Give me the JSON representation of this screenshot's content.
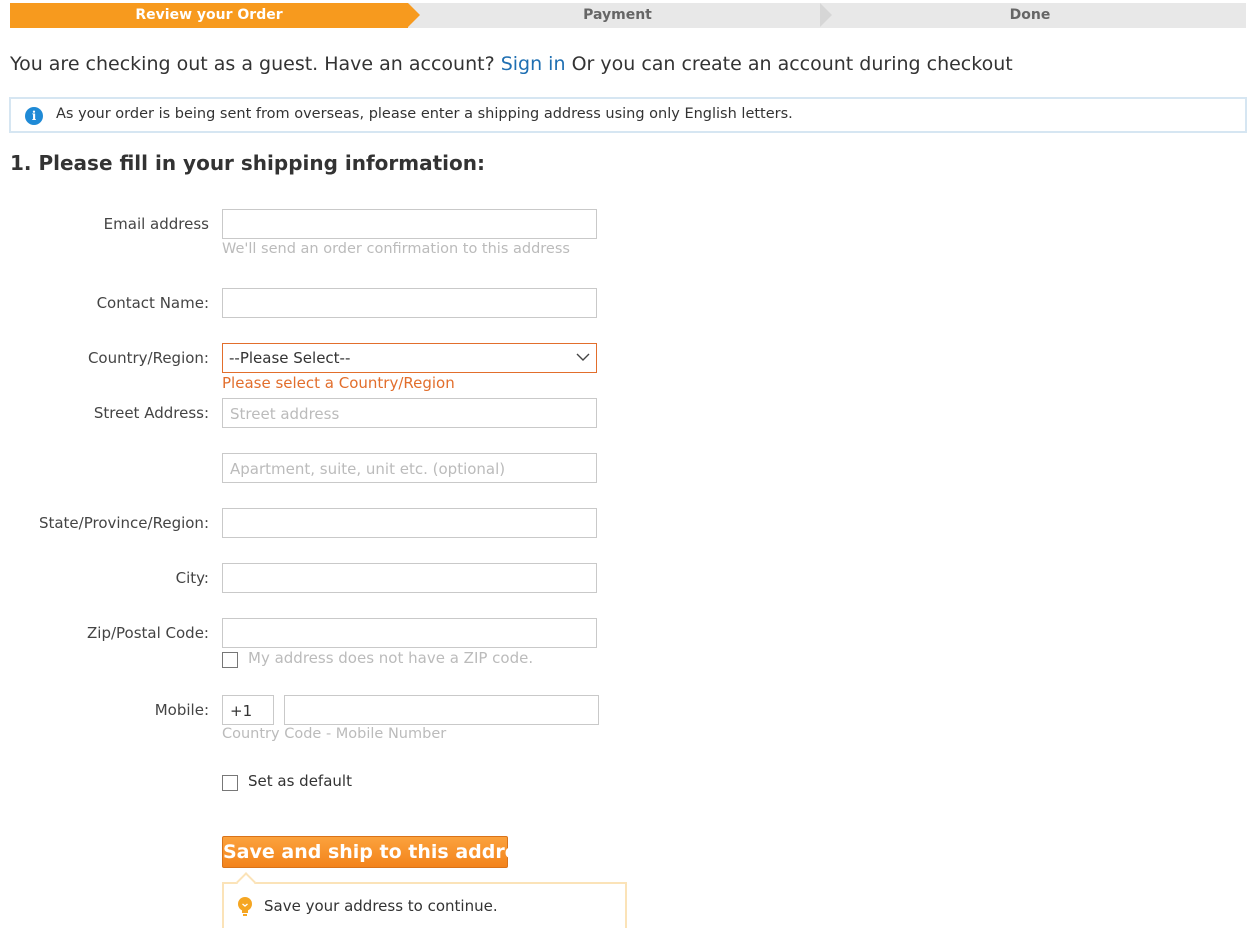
{
  "steps": [
    "Review your Order",
    "Payment",
    "Done"
  ],
  "guest": {
    "prefix": "You are checking out as a guest. Have an account?",
    "sign_in": "Sign in",
    "suffix": "Or you can create an account during checkout"
  },
  "notice": {
    "icon": "info-icon",
    "text": "As your order is being sent from overseas, please enter a shipping address using only English letters."
  },
  "section_title": "1. Please fill in your shipping information:",
  "form": {
    "email_label": "Email address",
    "email_hint": "We'll send an order confirmation to this address",
    "contact_label": "Contact Name:",
    "country_label": "Country/Region:",
    "country_value": "--Please Select--",
    "country_error": "Please select a Country/Region",
    "street_label": "Street Address:",
    "street_placeholder": "Street address",
    "apt_placeholder": "Apartment, suite, unit etc. (optional)",
    "state_label": "State/Province/Region:",
    "city_label": "City:",
    "zip_label": "Zip/Postal Code:",
    "no_zip_label": "My address does not have a ZIP code.",
    "mobile_label": "Mobile:",
    "mobile_code": "+1",
    "mobile_hint": "Country Code - Mobile Number",
    "default_label": "Set as default"
  },
  "save_button": "Save and ship to this address",
  "tip": {
    "icon": "lightbulb-icon",
    "text": "Save your address to continue."
  },
  "colors": {
    "accent": "#f79a1e",
    "link": "#1f6fb2",
    "error": "#e26e2c",
    "info": "#1f8ad6"
  }
}
